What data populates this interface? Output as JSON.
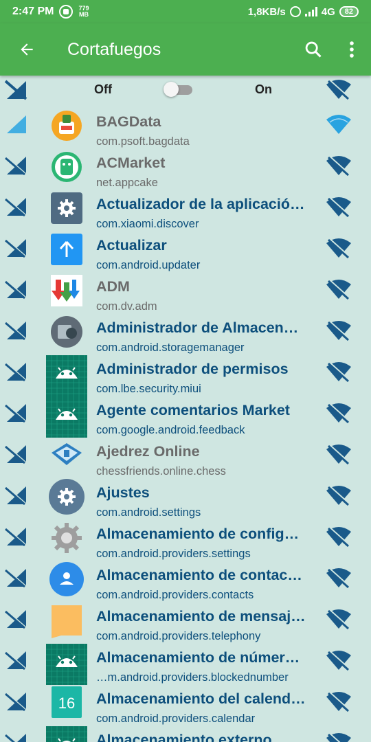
{
  "status": {
    "time": "2:47 PM",
    "data_rate_value": "779",
    "data_rate_unit": "MB",
    "net_speed": "1,8KB/s",
    "network": "4G",
    "battery": "82"
  },
  "appbar": {
    "title": "Cortafuegos",
    "back_icon": "arrow-back-icon",
    "search_icon": "search-icon",
    "more_icon": "more-vert-icon"
  },
  "toggle": {
    "off_label": "Off",
    "on_label": "On",
    "state": "off"
  },
  "colors": {
    "accent": "#4caf50",
    "background": "#cfe6e1",
    "system_text": "#0d4f7c",
    "user_text": "#6a6a6a",
    "icon_blue": "#1a5a8a",
    "wifi_allowed": "#29a3e0"
  },
  "apps": [
    {
      "name": "BAGData",
      "package": "com.psoft.bagdata",
      "kind": "user",
      "cell": "allowed",
      "wifi": "allowed",
      "icon": "bagdata-icon"
    },
    {
      "name": "ACMarket",
      "package": "net.appcake",
      "kind": "user",
      "cell": "blocked",
      "wifi": "blocked",
      "icon": "acmarket-icon"
    },
    {
      "name": "Actualizador de la aplicació…",
      "package": "com.xiaomi.discover",
      "kind": "sys",
      "cell": "blocked",
      "wifi": "blocked",
      "icon": "gear-square-icon"
    },
    {
      "name": "Actualizar",
      "package": "com.android.updater",
      "kind": "sys",
      "cell": "blocked",
      "wifi": "blocked",
      "icon": "arrow-up-square-icon"
    },
    {
      "name": "ADM",
      "package": "com.dv.adm",
      "kind": "user",
      "cell": "blocked",
      "wifi": "blocked",
      "icon": "adm-icon"
    },
    {
      "name": "Administrador de Almacen…",
      "package": "com.android.storagemanager",
      "kind": "sys",
      "cell": "blocked",
      "wifi": "blocked",
      "icon": "storage-icon"
    },
    {
      "name": "Administrador de permisos",
      "package": "com.lbe.security.miui",
      "kind": "sys",
      "cell": "blocked",
      "wifi": "blocked",
      "icon": "android-icon"
    },
    {
      "name": "Agente comentarios Market",
      "package": "com.google.android.feedback",
      "kind": "sys",
      "cell": "blocked",
      "wifi": "blocked",
      "icon": "android-icon"
    },
    {
      "name": "Ajedrez Online",
      "package": "chessfriends.online.chess",
      "kind": "user",
      "cell": "blocked",
      "wifi": "blocked",
      "icon": "chess-icon"
    },
    {
      "name": "Ajustes",
      "package": "com.android.settings",
      "kind": "sys",
      "cell": "blocked",
      "wifi": "blocked",
      "icon": "gear-circle-icon"
    },
    {
      "name": "Almacenamiento de config…",
      "package": "com.android.providers.settings",
      "kind": "sys",
      "cell": "blocked",
      "wifi": "blocked",
      "icon": "gear-grey-icon"
    },
    {
      "name": "Almacenamiento de contac…",
      "package": "com.android.providers.contacts",
      "kind": "sys",
      "cell": "blocked",
      "wifi": "blocked",
      "icon": "contacts-icon"
    },
    {
      "name": "Almacenamiento de mensaj…",
      "package": "com.android.providers.telephony",
      "kind": "sys",
      "cell": "blocked",
      "wifi": "blocked",
      "icon": "message-icon"
    },
    {
      "name": "Almacenamiento de númer…",
      "package": "…m.android.providers.blockednumber",
      "kind": "sys",
      "cell": "blocked",
      "wifi": "blocked",
      "icon": "android-icon"
    },
    {
      "name": "Almacenamiento del calend…",
      "package": "com.android.providers.calendar",
      "kind": "sys",
      "cell": "blocked",
      "wifi": "blocked",
      "icon": "calendar-icon",
      "icon_text": "16"
    },
    {
      "name": "Almacenamiento externo",
      "package": "",
      "kind": "sys",
      "cell": "blocked",
      "wifi": "blocked",
      "icon": "android-icon"
    }
  ]
}
